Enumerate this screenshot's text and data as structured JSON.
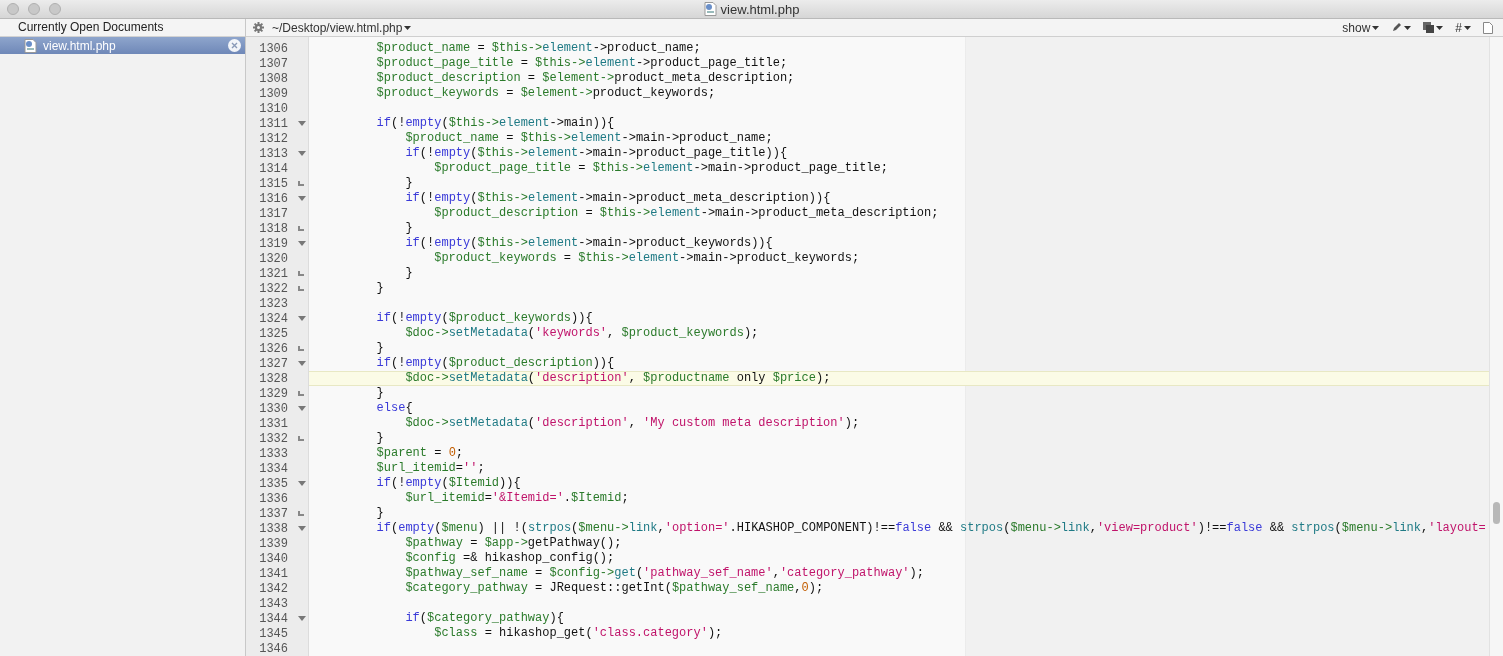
{
  "window": {
    "title": "view.html.php"
  },
  "sidebar": {
    "header": "Currently Open Documents",
    "items": [
      {
        "label": "view.html.php",
        "selected": true
      }
    ]
  },
  "editor_toolbar": {
    "path": "~/Desktop/view.html.php",
    "show_menu": "show",
    "number_menu": "#"
  },
  "code": {
    "lines": [
      {
        "number": "1306",
        "fold_start": false,
        "fold_end": false,
        "current": false,
        "tokens": [
          {
            "kind": "var",
            "text": "        $product_name"
          },
          {
            "kind": "txt",
            "text": " = "
          },
          {
            "kind": "var",
            "text": "$this->"
          },
          {
            "kind": "fn",
            "text": "element"
          },
          {
            "kind": "txt",
            "text": "->product_name;"
          }
        ]
      },
      {
        "number": "1307",
        "fold_start": false,
        "fold_end": false,
        "current": false,
        "tokens": [
          {
            "kind": "var",
            "text": "        $product_page_title"
          },
          {
            "kind": "txt",
            "text": " = "
          },
          {
            "kind": "var",
            "text": "$this->"
          },
          {
            "kind": "fn",
            "text": "element"
          },
          {
            "kind": "txt",
            "text": "->product_page_title;"
          }
        ]
      },
      {
        "number": "1308",
        "fold_start": false,
        "fold_end": false,
        "current": false,
        "tokens": [
          {
            "kind": "var",
            "text": "        $product_description"
          },
          {
            "kind": "txt",
            "text": " = "
          },
          {
            "kind": "var",
            "text": "$element->"
          },
          {
            "kind": "txt",
            "text": "product_meta_description;"
          }
        ]
      },
      {
        "number": "1309",
        "fold_start": false,
        "fold_end": false,
        "current": false,
        "tokens": [
          {
            "kind": "var",
            "text": "        $product_keywords"
          },
          {
            "kind": "txt",
            "text": " = "
          },
          {
            "kind": "var",
            "text": "$element->"
          },
          {
            "kind": "txt",
            "text": "product_keywords;"
          }
        ]
      },
      {
        "number": "1310",
        "fold_start": false,
        "fold_end": false,
        "current": false
      },
      {
        "number": "1311",
        "fold_start": true,
        "fold_end": false,
        "current": false,
        "tokens": [
          {
            "kind": "kw",
            "text": "        if"
          },
          {
            "kind": "txt",
            "text": "(!"
          },
          {
            "kind": "kw",
            "text": "empty"
          },
          {
            "kind": "txt",
            "text": "("
          },
          {
            "kind": "var",
            "text": "$this->"
          },
          {
            "kind": "fn",
            "text": "element"
          },
          {
            "kind": "txt",
            "text": "->main)){"
          }
        ]
      },
      {
        "number": "1312",
        "fold_start": false,
        "fold_end": false,
        "current": false,
        "tokens": [
          {
            "kind": "var",
            "text": "            $product_name"
          },
          {
            "kind": "txt",
            "text": " = "
          },
          {
            "kind": "var",
            "text": "$this->"
          },
          {
            "kind": "fn",
            "text": "element"
          },
          {
            "kind": "txt",
            "text": "->main->product_name;"
          }
        ]
      },
      {
        "number": "1313",
        "fold_start": true,
        "fold_end": false,
        "current": false,
        "tokens": [
          {
            "kind": "kw",
            "text": "            if"
          },
          {
            "kind": "txt",
            "text": "(!"
          },
          {
            "kind": "kw",
            "text": "empty"
          },
          {
            "kind": "txt",
            "text": "("
          },
          {
            "kind": "var",
            "text": "$this->"
          },
          {
            "kind": "fn",
            "text": "element"
          },
          {
            "kind": "txt",
            "text": "->main->product_page_title)){"
          }
        ]
      },
      {
        "number": "1314",
        "fold_start": false,
        "fold_end": false,
        "current": false,
        "tokens": [
          {
            "kind": "var",
            "text": "                $product_page_title"
          },
          {
            "kind": "txt",
            "text": " = "
          },
          {
            "kind": "var",
            "text": "$this->"
          },
          {
            "kind": "fn",
            "text": "element"
          },
          {
            "kind": "txt",
            "text": "->main->product_page_title;"
          }
        ]
      },
      {
        "number": "1315",
        "fold_start": false,
        "fold_end": true,
        "current": false,
        "tokens": [
          {
            "kind": "txt",
            "text": "            }"
          }
        ]
      },
      {
        "number": "1316",
        "fold_start": true,
        "fold_end": false,
        "current": false,
        "tokens": [
          {
            "kind": "kw",
            "text": "            if"
          },
          {
            "kind": "txt",
            "text": "(!"
          },
          {
            "kind": "kw",
            "text": "empty"
          },
          {
            "kind": "txt",
            "text": "("
          },
          {
            "kind": "var",
            "text": "$this->"
          },
          {
            "kind": "fn",
            "text": "element"
          },
          {
            "kind": "txt",
            "text": "->main->product_meta_description)){"
          }
        ]
      },
      {
        "number": "1317",
        "fold_start": false,
        "fold_end": false,
        "current": false,
        "tokens": [
          {
            "kind": "var",
            "text": "                $product_description"
          },
          {
            "kind": "txt",
            "text": " = "
          },
          {
            "kind": "var",
            "text": "$this->"
          },
          {
            "kind": "fn",
            "text": "element"
          },
          {
            "kind": "txt",
            "text": "->main->product_meta_description;"
          }
        ]
      },
      {
        "number": "1318",
        "fold_start": false,
        "fold_end": true,
        "current": false,
        "tokens": [
          {
            "kind": "txt",
            "text": "            }"
          }
        ]
      },
      {
        "number": "1319",
        "fold_start": true,
        "fold_end": false,
        "current": false,
        "tokens": [
          {
            "kind": "kw",
            "text": "            if"
          },
          {
            "kind": "txt",
            "text": "(!"
          },
          {
            "kind": "kw",
            "text": "empty"
          },
          {
            "kind": "txt",
            "text": "("
          },
          {
            "kind": "var",
            "text": "$this->"
          },
          {
            "kind": "fn",
            "text": "element"
          },
          {
            "kind": "txt",
            "text": "->main->product_keywords)){"
          }
        ]
      },
      {
        "number": "1320",
        "fold_start": false,
        "fold_end": false,
        "current": false,
        "tokens": [
          {
            "kind": "var",
            "text": "                $product_keywords"
          },
          {
            "kind": "txt",
            "text": " = "
          },
          {
            "kind": "var",
            "text": "$this->"
          },
          {
            "kind": "fn",
            "text": "element"
          },
          {
            "kind": "txt",
            "text": "->main->product_keywords;"
          }
        ]
      },
      {
        "number": "1321",
        "fold_start": false,
        "fold_end": true,
        "current": false,
        "tokens": [
          {
            "kind": "txt",
            "text": "            }"
          }
        ]
      },
      {
        "number": "1322",
        "fold_start": false,
        "fold_end": true,
        "current": false,
        "tokens": [
          {
            "kind": "txt",
            "text": "        }"
          }
        ]
      },
      {
        "number": "1323",
        "fold_start": false,
        "fold_end": false,
        "current": false
      },
      {
        "number": "1324",
        "fold_start": true,
        "fold_end": false,
        "current": false,
        "tokens": [
          {
            "kind": "kw",
            "text": "        if"
          },
          {
            "kind": "txt",
            "text": "(!"
          },
          {
            "kind": "kw",
            "text": "empty"
          },
          {
            "kind": "txt",
            "text": "("
          },
          {
            "kind": "var",
            "text": "$product_keywords"
          },
          {
            "kind": "txt",
            "text": ")){"
          }
        ]
      },
      {
        "number": "1325",
        "fold_start": false,
        "fold_end": false,
        "current": false,
        "tokens": [
          {
            "kind": "var",
            "text": "            $doc->"
          },
          {
            "kind": "fn",
            "text": "setMetadata"
          },
          {
            "kind": "txt",
            "text": "("
          },
          {
            "kind": "str",
            "text": "'keywords'"
          },
          {
            "kind": "txt",
            "text": ", "
          },
          {
            "kind": "var",
            "text": "$product_keywords"
          },
          {
            "kind": "txt",
            "text": ");"
          }
        ]
      },
      {
        "number": "1326",
        "fold_start": false,
        "fold_end": true,
        "current": false,
        "tokens": [
          {
            "kind": "txt",
            "text": "        }"
          }
        ]
      },
      {
        "number": "1327",
        "fold_start": true,
        "fold_end": false,
        "current": false,
        "tokens": [
          {
            "kind": "kw",
            "text": "        if"
          },
          {
            "kind": "txt",
            "text": "(!"
          },
          {
            "kind": "kw",
            "text": "empty"
          },
          {
            "kind": "txt",
            "text": "("
          },
          {
            "kind": "var",
            "text": "$product_description"
          },
          {
            "kind": "txt",
            "text": ")){"
          }
        ]
      },
      {
        "number": "1328",
        "fold_start": false,
        "fold_end": false,
        "current": true,
        "tokens": [
          {
            "kind": "var",
            "text": "            $doc->"
          },
          {
            "kind": "fn",
            "text": "setMetadata"
          },
          {
            "kind": "txt",
            "text": "("
          },
          {
            "kind": "str",
            "text": "'description'"
          },
          {
            "kind": "txt",
            "text": ", "
          },
          {
            "kind": "var",
            "text": "$productname"
          },
          {
            "kind": "txt",
            "text": " only "
          },
          {
            "kind": "var",
            "text": "$price"
          },
          {
            "kind": "txt",
            "text": ");"
          }
        ]
      },
      {
        "number": "1329",
        "fold_start": false,
        "fold_end": true,
        "current": false,
        "tokens": [
          {
            "kind": "txt",
            "text": "        }"
          }
        ]
      },
      {
        "number": "1330",
        "fold_start": true,
        "fold_end": false,
        "current": false,
        "tokens": [
          {
            "kind": "kw",
            "text": "        else"
          },
          {
            "kind": "txt",
            "text": "{"
          }
        ]
      },
      {
        "number": "1331",
        "fold_start": false,
        "fold_end": false,
        "current": false,
        "tokens": [
          {
            "kind": "var",
            "text": "            $doc->"
          },
          {
            "kind": "fn",
            "text": "setMetadata"
          },
          {
            "kind": "txt",
            "text": "("
          },
          {
            "kind": "str",
            "text": "'description'"
          },
          {
            "kind": "txt",
            "text": ", "
          },
          {
            "kind": "str",
            "text": "'My custom meta description'"
          },
          {
            "kind": "txt",
            "text": ");"
          }
        ]
      },
      {
        "number": "1332",
        "fold_start": false,
        "fold_end": true,
        "current": false,
        "tokens": [
          {
            "kind": "txt",
            "text": "        }"
          }
        ]
      },
      {
        "number": "1333",
        "fold_start": false,
        "fold_end": false,
        "current": false,
        "tokens": [
          {
            "kind": "var",
            "text": "        $parent"
          },
          {
            "kind": "txt",
            "text": " = "
          },
          {
            "kind": "num",
            "text": "0"
          },
          {
            "kind": "txt",
            "text": ";"
          }
        ]
      },
      {
        "number": "1334",
        "fold_start": false,
        "fold_end": false,
        "current": false,
        "tokens": [
          {
            "kind": "var",
            "text": "        $url_itemid"
          },
          {
            "kind": "txt",
            "text": "="
          },
          {
            "kind": "str",
            "text": "''"
          },
          {
            "kind": "txt",
            "text": ";"
          }
        ]
      },
      {
        "number": "1335",
        "fold_start": true,
        "fold_end": false,
        "current": false,
        "tokens": [
          {
            "kind": "kw",
            "text": "        if"
          },
          {
            "kind": "txt",
            "text": "(!"
          },
          {
            "kind": "kw",
            "text": "empty"
          },
          {
            "kind": "txt",
            "text": "("
          },
          {
            "kind": "var",
            "text": "$Itemid"
          },
          {
            "kind": "txt",
            "text": ")){"
          }
        ]
      },
      {
        "number": "1336",
        "fold_start": false,
        "fold_end": false,
        "current": false,
        "tokens": [
          {
            "kind": "var",
            "text": "            $url_itemid"
          },
          {
            "kind": "txt",
            "text": "="
          },
          {
            "kind": "str",
            "text": "'&Itemid='"
          },
          {
            "kind": "txt",
            "text": "."
          },
          {
            "kind": "var",
            "text": "$Itemid"
          },
          {
            "kind": "txt",
            "text": ";"
          }
        ]
      },
      {
        "number": "1337",
        "fold_start": false,
        "fold_end": true,
        "current": false,
        "tokens": [
          {
            "kind": "txt",
            "text": "        }"
          }
        ]
      },
      {
        "number": "1338",
        "fold_start": true,
        "fold_end": false,
        "current": false,
        "tokens": [
          {
            "kind": "kw",
            "text": "        if"
          },
          {
            "kind": "txt",
            "text": "("
          },
          {
            "kind": "kw",
            "text": "empty"
          },
          {
            "kind": "txt",
            "text": "("
          },
          {
            "kind": "var",
            "text": "$menu"
          },
          {
            "kind": "txt",
            "text": ") || !("
          },
          {
            "kind": "fn",
            "text": "strpos"
          },
          {
            "kind": "txt",
            "text": "("
          },
          {
            "kind": "var",
            "text": "$menu->"
          },
          {
            "kind": "fn",
            "text": "link"
          },
          {
            "kind": "txt",
            "text": ","
          },
          {
            "kind": "str",
            "text": "'option='"
          },
          {
            "kind": "txt",
            "text": ".HIKASHOP_COMPONENT)!=="
          },
          {
            "kind": "kw",
            "text": "false"
          },
          {
            "kind": "txt",
            "text": " && "
          },
          {
            "kind": "fn",
            "text": "strpos"
          },
          {
            "kind": "txt",
            "text": "("
          },
          {
            "kind": "var",
            "text": "$menu->"
          },
          {
            "kind": "fn",
            "text": "link"
          },
          {
            "kind": "txt",
            "text": ","
          },
          {
            "kind": "str",
            "text": "'view=product'"
          },
          {
            "kind": "txt",
            "text": ")!=="
          },
          {
            "kind": "kw",
            "text": "false"
          },
          {
            "kind": "txt",
            "text": " && "
          },
          {
            "kind": "fn",
            "text": "strpos"
          },
          {
            "kind": "txt",
            "text": "("
          },
          {
            "kind": "var",
            "text": "$menu->"
          },
          {
            "kind": "fn",
            "text": "link"
          },
          {
            "kind": "txt",
            "text": ","
          },
          {
            "kind": "str",
            "text": "'layout="
          }
        ]
      },
      {
        "number": "1339",
        "fold_start": false,
        "fold_end": false,
        "current": false,
        "tokens": [
          {
            "kind": "var",
            "text": "            $pathway"
          },
          {
            "kind": "txt",
            "text": " = "
          },
          {
            "kind": "var",
            "text": "$app->"
          },
          {
            "kind": "txt",
            "text": "getPathway();"
          }
        ]
      },
      {
        "number": "1340",
        "fold_start": false,
        "fold_end": false,
        "current": false,
        "tokens": [
          {
            "kind": "var",
            "text": "            $config"
          },
          {
            "kind": "txt",
            "text": " =& hikashop_config();"
          }
        ]
      },
      {
        "number": "1341",
        "fold_start": false,
        "fold_end": false,
        "current": false,
        "tokens": [
          {
            "kind": "var",
            "text": "            $pathway_sef_name"
          },
          {
            "kind": "txt",
            "text": " = "
          },
          {
            "kind": "var",
            "text": "$config->"
          },
          {
            "kind": "fn",
            "text": "get"
          },
          {
            "kind": "txt",
            "text": "("
          },
          {
            "kind": "str",
            "text": "'pathway_sef_name'"
          },
          {
            "kind": "txt",
            "text": ","
          },
          {
            "kind": "str",
            "text": "'category_pathway'"
          },
          {
            "kind": "txt",
            "text": ");"
          }
        ]
      },
      {
        "number": "1342",
        "fold_start": false,
        "fold_end": false,
        "current": false,
        "tokens": [
          {
            "kind": "var",
            "text": "            $category_pathway"
          },
          {
            "kind": "txt",
            "text": " = JRequest::getInt("
          },
          {
            "kind": "var",
            "text": "$pathway_sef_name"
          },
          {
            "kind": "txt",
            "text": ","
          },
          {
            "kind": "num",
            "text": "0"
          },
          {
            "kind": "txt",
            "text": ");"
          }
        ]
      },
      {
        "number": "1343",
        "fold_start": false,
        "fold_end": false,
        "current": false
      },
      {
        "number": "1344",
        "fold_start": true,
        "fold_end": false,
        "current": false,
        "tokens": [
          {
            "kind": "kw",
            "text": "            if"
          },
          {
            "kind": "txt",
            "text": "("
          },
          {
            "kind": "var",
            "text": "$category_pathway"
          },
          {
            "kind": "txt",
            "text": "){"
          }
        ]
      },
      {
        "number": "1345",
        "fold_start": false,
        "fold_end": false,
        "current": false,
        "tokens": [
          {
            "kind": "var",
            "text": "                $class"
          },
          {
            "kind": "txt",
            "text": " = hikashop_get("
          },
          {
            "kind": "str",
            "text": "'class.category'"
          },
          {
            "kind": "txt",
            "text": ");"
          }
        ]
      },
      {
        "number": "1346",
        "fold_start": false,
        "fold_end": false,
        "current": false
      }
    ]
  }
}
